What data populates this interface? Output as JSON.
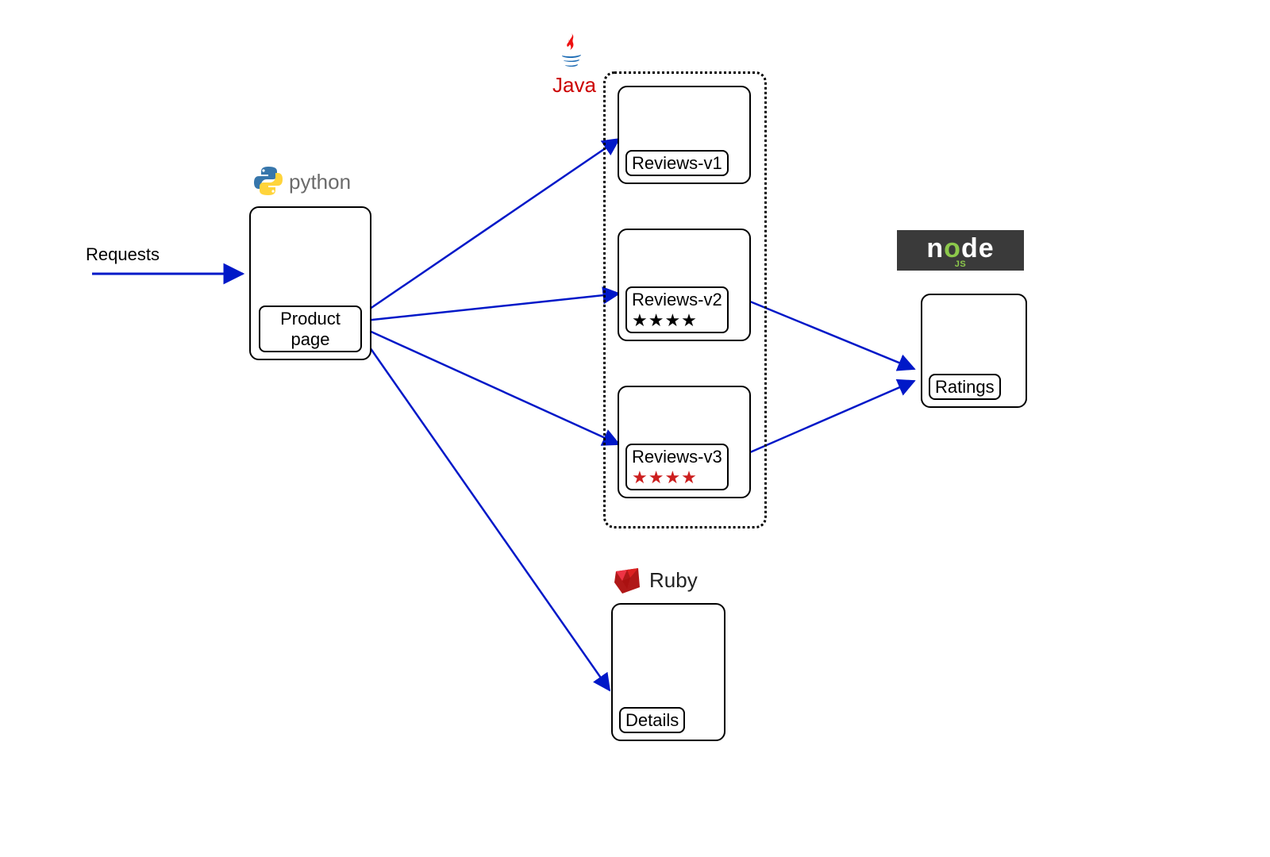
{
  "labels": {
    "requests": "Requests",
    "python": "python",
    "java": "Java",
    "ruby": "Ruby",
    "node": "node",
    "nodejs_sub": "JS"
  },
  "nodes": {
    "product_page": "Product page",
    "reviews_v1": "Reviews-v1",
    "reviews_v2": "Reviews-v2",
    "reviews_v3": "Reviews-v3",
    "ratings": "Ratings",
    "details": "Details"
  },
  "stars": {
    "v2": "★★★★",
    "v3": "★★★★"
  },
  "diagram": {
    "description": "Microservices architecture: external Requests go to a Python Product page service. Product page fans out to Java Reviews (v1, v2, v3) and to a Ruby Details service. Reviews v2 and v3 call a Node.js Ratings service. Reviews v2 shows black stars, Reviews v3 shows red stars; Reviews v1 shows none.",
    "services": [
      {
        "name": "Product page",
        "tech": "Python"
      },
      {
        "name": "Reviews-v1",
        "tech": "Java",
        "stars": null
      },
      {
        "name": "Reviews-v2",
        "tech": "Java",
        "stars": "black"
      },
      {
        "name": "Reviews-v3",
        "tech": "Java",
        "stars": "red"
      },
      {
        "name": "Ratings",
        "tech": "Node.js"
      },
      {
        "name": "Details",
        "tech": "Ruby"
      }
    ],
    "edges": [
      [
        "Requests",
        "Product page"
      ],
      [
        "Product page",
        "Reviews-v1"
      ],
      [
        "Product page",
        "Reviews-v2"
      ],
      [
        "Product page",
        "Reviews-v3"
      ],
      [
        "Product page",
        "Details"
      ],
      [
        "Reviews-v2",
        "Ratings"
      ],
      [
        "Reviews-v3",
        "Ratings"
      ]
    ]
  }
}
